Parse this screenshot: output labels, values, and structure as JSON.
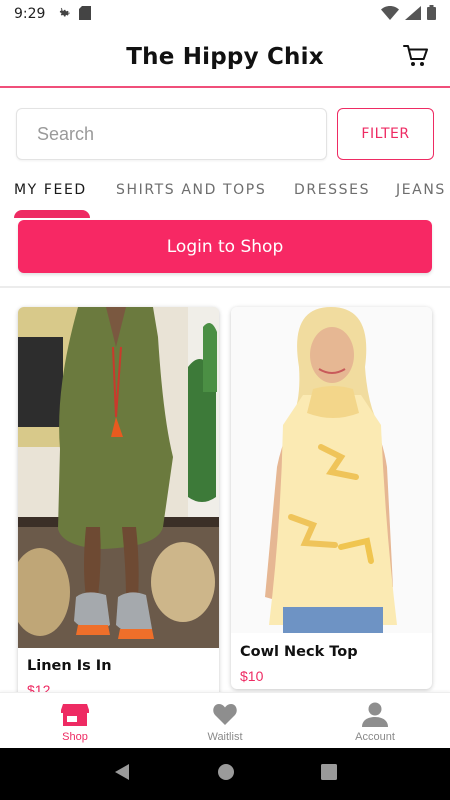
{
  "status_bar": {
    "time": "9:29",
    "left_icons": [
      "gear-icon",
      "sd-card-icon"
    ],
    "right_icons": [
      "wifi-icon",
      "signal-icon",
      "battery-icon"
    ]
  },
  "header": {
    "title": "The Hippy Chix",
    "cart_icon": "cart-icon"
  },
  "search": {
    "placeholder": "Search",
    "value": "",
    "filter_label": "FILTER"
  },
  "tabs": [
    {
      "label": "MY FEED",
      "active": true
    },
    {
      "label": "SHIRTS AND TOPS",
      "active": false
    },
    {
      "label": "DRESSES",
      "active": false
    },
    {
      "label": "JEANS",
      "active": false
    }
  ],
  "login": {
    "label": "Login to Shop"
  },
  "products": [
    {
      "name": "Linen Is In",
      "price": "$12"
    },
    {
      "name": "Cowl Neck Top",
      "price": "$10"
    }
  ],
  "bottom_nav": [
    {
      "label": "Shop",
      "icon": "store-icon",
      "active": true
    },
    {
      "label": "Waitlist",
      "icon": "heart-icon",
      "active": false
    },
    {
      "label": "Account",
      "icon": "account-icon",
      "active": false
    }
  ],
  "colors": {
    "accent": "#ee2b63",
    "login_bg": "#f72864",
    "price": "#ee2b63"
  }
}
